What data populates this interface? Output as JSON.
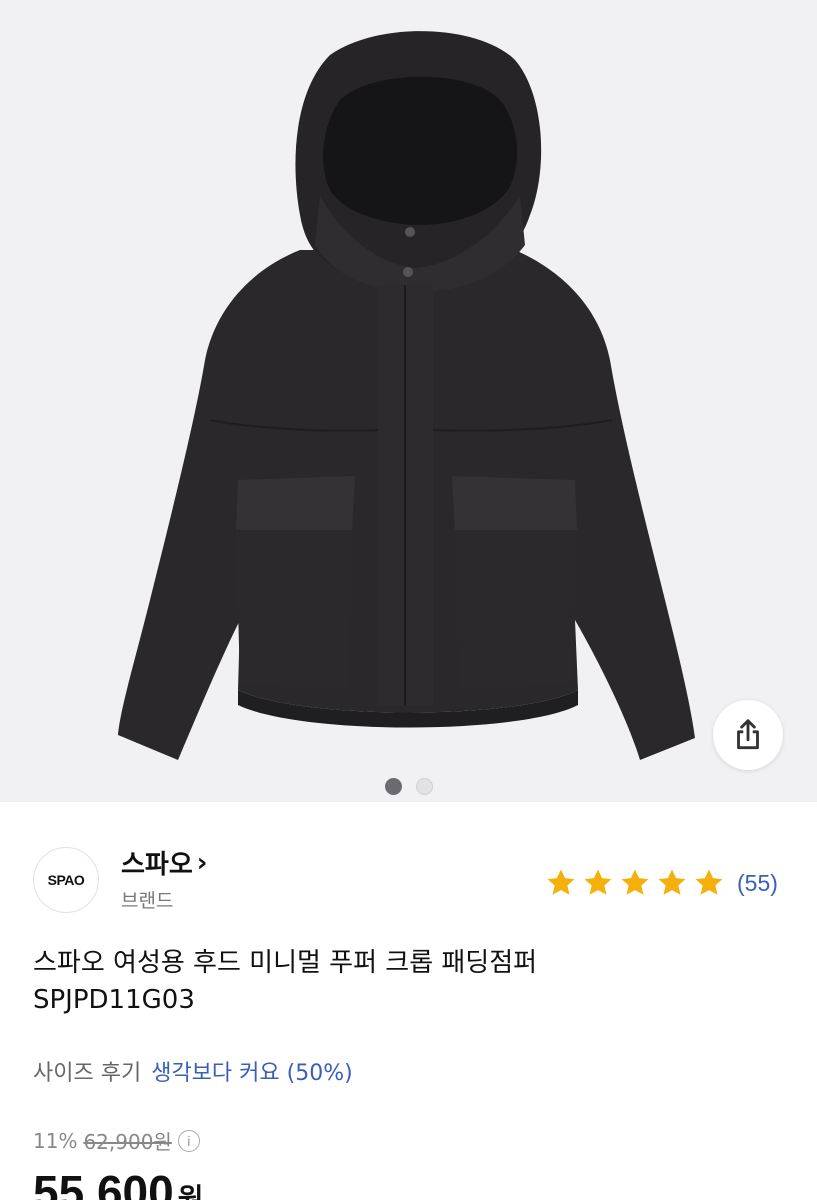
{
  "product_image": {
    "icon": "jacket-product-photo",
    "carousel": {
      "count": 2,
      "active_index": 0
    }
  },
  "share": {
    "icon": "share-icon"
  },
  "brand": {
    "logo_text": "SPAO",
    "name": "스파오",
    "name_chevron": "›",
    "subtitle": "브랜드"
  },
  "rating": {
    "stars": 5,
    "max_stars": 5,
    "star_color": "#f5b00b",
    "count_text": "(55)"
  },
  "product": {
    "title_line1": "스파오 여성용 후드 미니멀 푸퍼 크롭 패딩점퍼",
    "title_line2": "SPJPD11G03"
  },
  "size_review": {
    "label": "사이즈 후기",
    "value": "생각보다 커요 (50%)"
  },
  "price": {
    "discount": "11%",
    "original": "62,900원",
    "info_icon": "i",
    "sale_amount": "55,600",
    "sale_unit": "원"
  },
  "colors": {
    "accent_blue": "#3a5fb8",
    "hero_bg": "#f1f0f2"
  }
}
